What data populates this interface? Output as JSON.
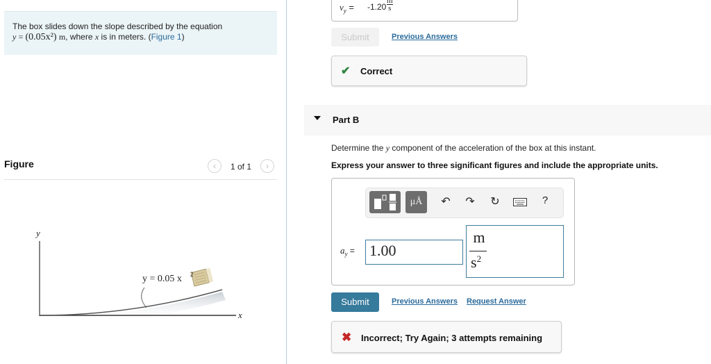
{
  "problem": {
    "line1": "The box slides down the slope described by the equation",
    "eq_lhs": "y",
    "eq_rhs": "(0.05x²)",
    "eq_unit": "m",
    "line2_mid": ", where",
    "var": "x",
    "line2_end": "is in meters. (",
    "figure_link": "Figure 1",
    "close_paren": ")"
  },
  "figure": {
    "title": "Figure",
    "pager": "1 of 1",
    "prev_icon": "‹",
    "next_icon": "›",
    "y_axis_label": "y",
    "x_axis_label": "x",
    "curve_label": "y = 0.05 x",
    "curve_label_exp": "2"
  },
  "part_a": {
    "var_label": "v",
    "var_sub": "y",
    "eq": " =",
    "value": "-1.20",
    "unit_num": "m",
    "unit_den": "s",
    "submit_label": "Submit",
    "previous_answers_label": "Previous Answers",
    "feedback_icon": "✔",
    "feedback_text": "Correct"
  },
  "part_b": {
    "title": "Part B",
    "question_pre": "Determine the",
    "question_var": "y",
    "question_post": "component of the acceleration of the box at this instant.",
    "instruction": "Express your answer to three significant figures and include the appropriate units.",
    "toolbar": {
      "units_label": "μÅ",
      "undo_icon": "↶",
      "redo_icon": "↷",
      "reset_icon": "↻",
      "keyboard_icon": "⌨",
      "help_label": "?"
    },
    "var_label": "a",
    "var_sub": "y",
    "eq": " =",
    "value": "1.00",
    "unit_num": "m",
    "unit_den": "s",
    "unit_exp": "2",
    "submit_label": "Submit",
    "previous_answers_label": "Previous Answers",
    "request_answer_label": "Request Answer",
    "feedback_icon": "✖",
    "feedback_text": "Incorrect; Try Again; 3 attempts remaining"
  },
  "colors": {
    "accent": "#367a9c",
    "link": "#2a6b9c",
    "correct": "#2e8540",
    "incorrect": "#c62828",
    "problem_bg": "#ebf4f7"
  }
}
